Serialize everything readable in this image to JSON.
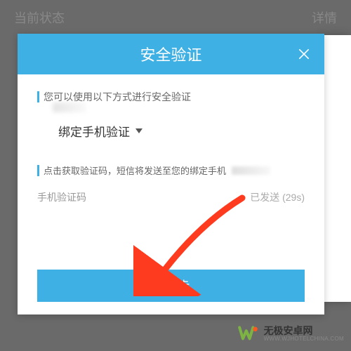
{
  "background": {
    "left_label": "当前状态",
    "right_label": "详情"
  },
  "modal": {
    "title": "安全验证",
    "info1": "您可以使用以下方式进行安全验证",
    "dropdown_label": "绑定手机验证",
    "info2": "点击获取验证码，短信将发送至您的绑定手机",
    "input_label": "手机验证码",
    "sent_label": "已发送 (29s)",
    "next_button": "下一步"
  },
  "watermark": {
    "cn": "无极安卓网",
    "url": "WWW.WJHOTELCHINA.COM"
  },
  "colors": {
    "accent": "#3eb0e4",
    "overlay": "rgba(80,80,80,0.85)"
  }
}
